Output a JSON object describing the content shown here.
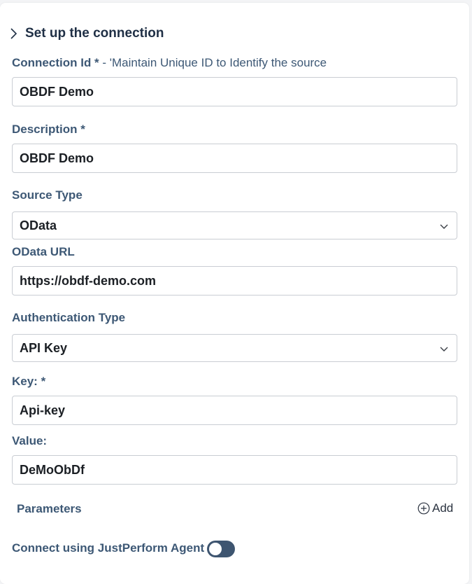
{
  "section": {
    "title": "Set up the connection"
  },
  "fields": {
    "connection_id": {
      "label": "Connection Id *",
      "hint": " - 'Maintain Unique ID to Identify the source",
      "value": "OBDF Demo"
    },
    "description": {
      "label": "Description *",
      "value": "OBDF Demo"
    },
    "source_type": {
      "label": "Source Type",
      "value": "OData"
    },
    "odata_url": {
      "label": "OData URL",
      "value": "https://obdf-demo.com"
    },
    "auth_type": {
      "label": "Authentication Type",
      "value": "API Key"
    },
    "key": {
      "label": "Key: *",
      "value": "Api-key"
    },
    "value": {
      "label": "Value:",
      "value": "DeMoObDf"
    }
  },
  "parameters": {
    "label": "Parameters",
    "add_label": "Add"
  },
  "agent": {
    "label": "Connect using JustPerform Agent",
    "enabled": true
  },
  "icons": {
    "header": "chevron-right-icon",
    "select": "chevron-down-icon",
    "add": "plus-circle-icon"
  },
  "colors": {
    "label": "#3d5875",
    "toggle": "#3e5570"
  }
}
